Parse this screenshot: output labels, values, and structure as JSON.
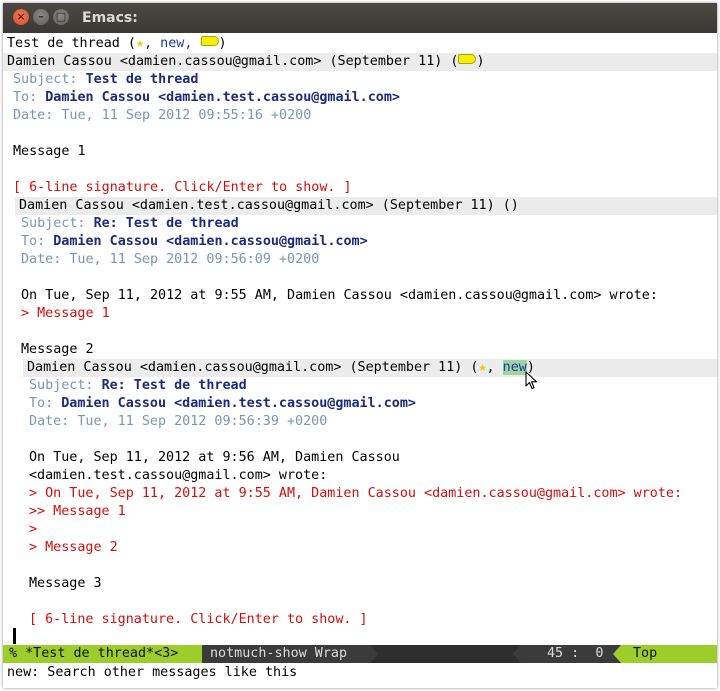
{
  "window": {
    "title": "Emacs:"
  },
  "thread": {
    "title": "Test de thread",
    "title_tags_prefix": " (",
    "title_tags_new": ", new, ",
    "title_tags_suffix": ")"
  },
  "messages": [
    {
      "from": "Damien Cassou <damien.cassou@gmail.com>",
      "date_short": "(September 11)",
      "subject_label": "Subject:",
      "subject": "Test de thread",
      "to_label": "To:",
      "to": "Damien Cassou <damien.test.cassou@gmail.com>",
      "date_label": "Date:",
      "date": "Tue, 11 Sep 2012 09:55:16 +0200",
      "body": "Message 1",
      "signature": "[ 6-line signature. Click/Enter to show. ]"
    },
    {
      "from": "Damien Cassou <damien.test.cassou@gmail.com>",
      "date_short": "(September 11) ()",
      "subject_label": "Subject:",
      "subject": "Re: Test de thread",
      "to_label": "To:",
      "to": "Damien Cassou <damien.cassou@gmail.com>",
      "date_label": "Date:",
      "date": "Tue, 11 Sep 2012 09:56:09 +0200",
      "quote_intro": "On Tue, Sep 11, 2012 at 9:55 AM, Damien Cassou <damien.cassou@gmail.com> wrote:",
      "quote_1": "> Message 1",
      "body": "Message 2"
    },
    {
      "from": "Damien Cassou <damien.cassou@gmail.com>",
      "date_short": "(September 11) (",
      "tag_new": "new",
      "subject_label": "Subject:",
      "subject": "Re: Test de thread",
      "to_label": "To:",
      "to": "Damien Cassou <damien.test.cassou@gmail.com>",
      "date_label": "Date:",
      "date": "Tue, 11 Sep 2012 09:56:39 +0200",
      "quote_intro_1": "On Tue, Sep 11, 2012 at 9:56 AM, Damien Cassou",
      "quote_intro_2": "<damien.test.cassou@gmail.com> wrote:",
      "quote_1": "> On Tue, Sep 11, 2012 at 9:55 AM, Damien Cassou <damien.cassou@gmail.com> wrote:",
      "quote_2": ">> Message 1",
      "quote_3": ">",
      "quote_4": "> Message 2",
      "body": "Message 3",
      "signature": "[ 6-line signature. Click/Enter to show. ]"
    }
  ],
  "modeline": {
    "buffer": "% *Test de thread*<3>",
    "mode": "notmuch-show Wrap",
    "position": "45 :  0",
    "scroll": "Top"
  },
  "echo": "new: Search other messages like this",
  "colors": {
    "modeline_accent": "#9ccd2b",
    "header_label": "#7896b4",
    "header_value": "#1c2b7d",
    "quote": "#d40d0d",
    "tag_highlight": "#9fd39f"
  }
}
